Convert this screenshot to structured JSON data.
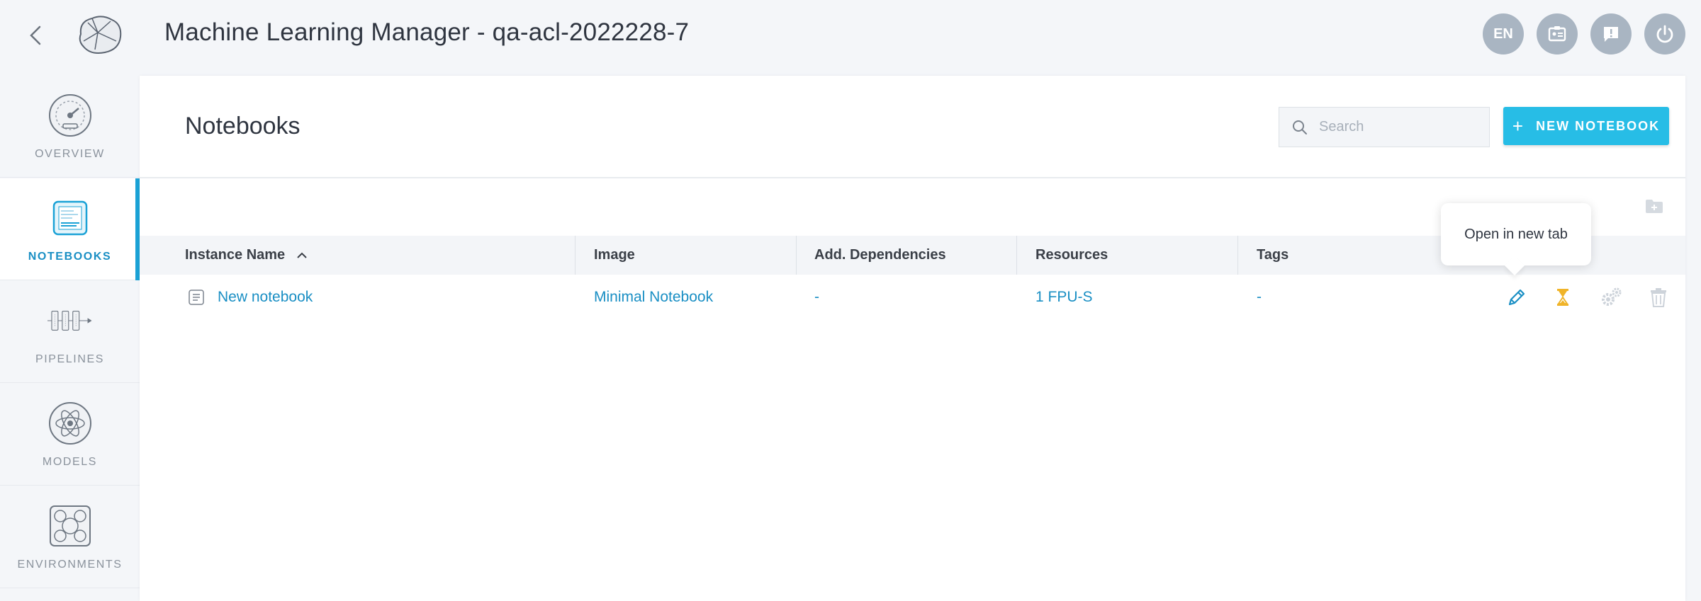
{
  "header": {
    "title": "Machine Learning Manager - qa-acl-2022228-7",
    "lang": "EN"
  },
  "sidebar": {
    "items": [
      {
        "label": "OVERVIEW",
        "icon": "gauge-icon"
      },
      {
        "label": "NOTEBOOKS",
        "icon": "notebook-icon",
        "active": true
      },
      {
        "label": "PIPELINES",
        "icon": "pipeline-icon"
      },
      {
        "label": "MODELS",
        "icon": "atom-icon"
      },
      {
        "label": "ENVIRONMENTS",
        "icon": "environment-icon"
      }
    ]
  },
  "main": {
    "title": "Notebooks",
    "search_placeholder": "Search",
    "new_button": "NEW NOTEBOOK",
    "columns": [
      "Instance Name",
      "Image",
      "Add. Dependencies",
      "Resources",
      "Tags"
    ],
    "rows": [
      {
        "name": "New notebook",
        "image": "Minimal Notebook",
        "dependencies": "-",
        "resources": "1 FPU-S",
        "tags": "-"
      }
    ],
    "tooltip": "Open in new tab"
  },
  "colors": {
    "accent": "#27bde6",
    "link": "#1a8fc4",
    "pending": "#f0b429"
  }
}
